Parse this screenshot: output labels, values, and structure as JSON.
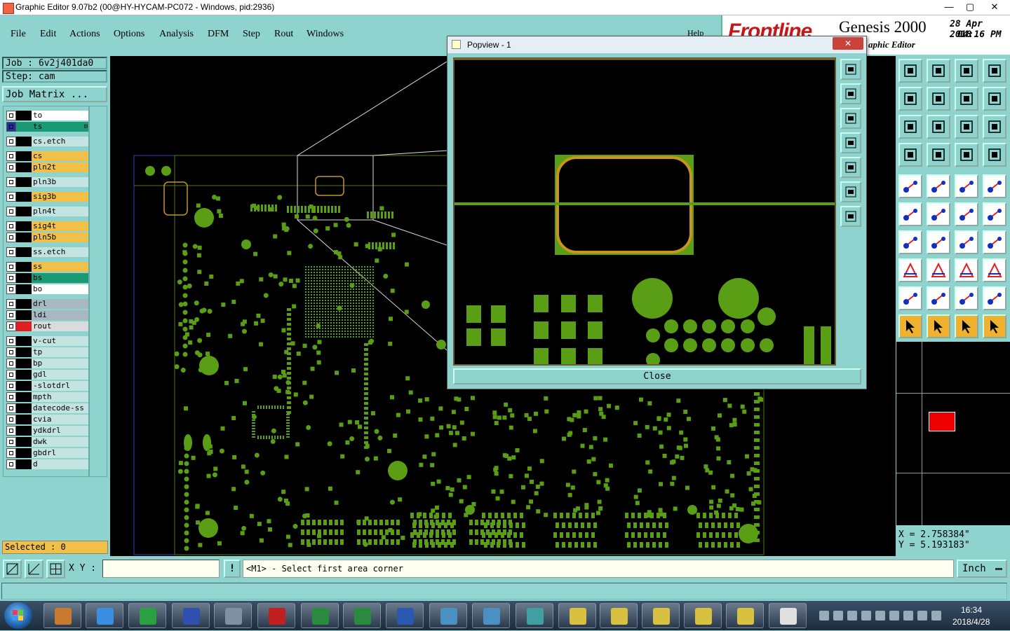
{
  "window": {
    "title": "Graphic Editor 9.07b2 (00@HY-HYCAM-PC072 - Windows, pid:2936)",
    "min": "—",
    "max": "▢",
    "close": "✕"
  },
  "menu": [
    "File",
    "Edit",
    "Actions",
    "Options",
    "Analysis",
    "DFM",
    "Step",
    "Rout",
    "Windows"
  ],
  "menu_help": "Help",
  "brand": {
    "logo": "Frontline",
    "product": "Genesis 2000",
    "subtitle": "aphic Editor",
    "date": "28 Apr 2018",
    "time": "04:16 PM"
  },
  "job": {
    "job_label": "Job : 6v2j401da0",
    "step_label": "Step: cam",
    "matrix_button": "Job Matrix ..."
  },
  "layers": [
    {
      "name": "to",
      "color": "#ffffff",
      "sw": "#000000",
      "group": 0
    },
    {
      "name": "ts",
      "color": "#1a9a74",
      "sw": "#1a9a74",
      "group": 0,
      "active": true
    },
    {
      "name": "cs.etch",
      "color": "#c4e4e2",
      "sw": "#000000",
      "group": 1
    },
    {
      "name": "cs",
      "color": "#f0c048",
      "sw": "#000000",
      "group": 2
    },
    {
      "name": "pln2t",
      "color": "#f0c048",
      "sw": "#000000",
      "group": 2
    },
    {
      "name": "pln3b",
      "color": "#c4e4e2",
      "sw": "#000000",
      "group": 3
    },
    {
      "name": "sig3b",
      "color": "#f0c048",
      "sw": "#000000",
      "group": 4
    },
    {
      "name": "pln4t",
      "color": "#c4e4e2",
      "sw": "#000000",
      "group": 5
    },
    {
      "name": "sig4t",
      "color": "#f0c048",
      "sw": "#000000",
      "group": 6
    },
    {
      "name": "pln5b",
      "color": "#f0c048",
      "sw": "#000000",
      "group": 6
    },
    {
      "name": "ss.etch",
      "color": "#c4e4e2",
      "sw": "#000000",
      "group": 7
    },
    {
      "name": "ss",
      "color": "#f0c048",
      "sw": "#000000",
      "group": 8
    },
    {
      "name": "bs",
      "color": "#1a9a74",
      "sw": "#000000",
      "group": 8
    },
    {
      "name": "bo",
      "color": "#ffffff",
      "sw": "#000000",
      "group": 8
    },
    {
      "name": "drl",
      "color": "#a8b8c0",
      "sw": "#000000",
      "group": 9
    },
    {
      "name": "ldi",
      "color": "#a8b8c0",
      "sw": "#000000",
      "group": 9
    },
    {
      "name": "rout",
      "color": "#d8dcdc",
      "sw": "#e02020",
      "group": 9
    },
    {
      "name": "v-cut",
      "color": "#c4e4e2",
      "sw": "#000000",
      "group": 10
    },
    {
      "name": "tp",
      "color": "#c4e4e2",
      "sw": "#000000",
      "group": 10
    },
    {
      "name": "bp",
      "color": "#c4e4e2",
      "sw": "#000000",
      "group": 10
    },
    {
      "name": "gdl",
      "color": "#c4e4e2",
      "sw": "#000000",
      "group": 10
    },
    {
      "name": "-slotdrl",
      "color": "#c4e4e2",
      "sw": "#000000",
      "group": 10
    },
    {
      "name": "mpth",
      "color": "#c4e4e2",
      "sw": "#000000",
      "group": 10
    },
    {
      "name": "datecode-ss",
      "color": "#c4e4e2",
      "sw": "#000000",
      "group": 10
    },
    {
      "name": "cvia",
      "color": "#c4e4e2",
      "sw": "#000000",
      "group": 10
    },
    {
      "name": "ydkdrl",
      "color": "#c4e4e2",
      "sw": "#000000",
      "group": 10
    },
    {
      "name": "dwk",
      "color": "#c4e4e2",
      "sw": "#000000",
      "group": 10
    },
    {
      "name": "gbdrl",
      "color": "#c4e4e2",
      "sw": "#000000",
      "group": 10
    },
    {
      "name": "d",
      "color": "#c4e4e2",
      "sw": "#000000",
      "group": 10
    }
  ],
  "selected": "Selected : 0",
  "popview": {
    "title": "Popview - 1",
    "close_button": "Close",
    "close_x": "✕"
  },
  "coords": {
    "x": "X = 2.758384\"",
    "y": "Y = 5.193183\""
  },
  "status": {
    "xy_label": "X Y :",
    "xy_value": "",
    "message": "<M1> - Select first area corner",
    "units": "Inch",
    "alert": "!"
  },
  "taskbar": {
    "time": "16:34",
    "date": "2018/4/28"
  },
  "colors": {
    "pad": "#5a9e16",
    "outline": "#c8961e",
    "panel": "#8fd3cf",
    "profile": "#3040c0"
  }
}
